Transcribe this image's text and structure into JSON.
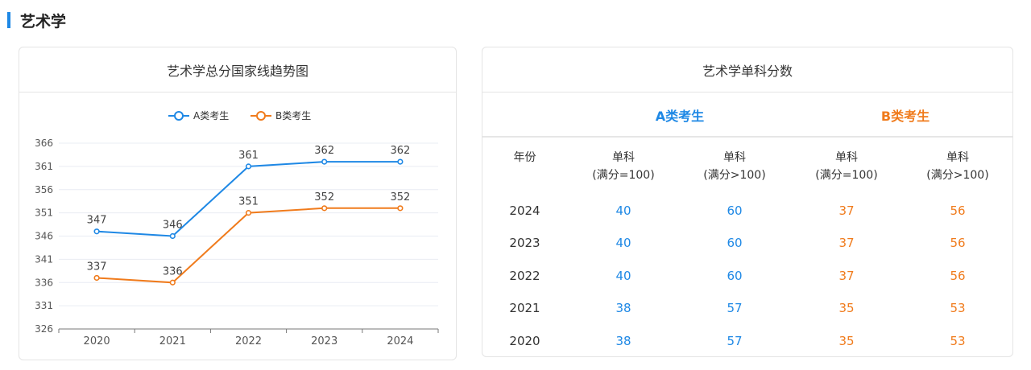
{
  "section": {
    "title": "艺术学"
  },
  "colors": {
    "accent": "#1e88e5",
    "series_a": "#1e88e5",
    "series_b": "#f07b1c",
    "year_text": "#333333"
  },
  "chart_card": {
    "title": "艺术学总分国家线趋势图"
  },
  "chart_data": {
    "type": "line",
    "title": "艺术学总分国家线趋势图",
    "x": [
      "2020",
      "2021",
      "2022",
      "2023",
      "2024"
    ],
    "series": [
      {
        "name": "A类考生",
        "values": [
          347,
          346,
          361,
          362,
          362
        ],
        "color": "#1e88e5"
      },
      {
        "name": "B类考生",
        "values": [
          337,
          336,
          351,
          352,
          352
        ],
        "color": "#f07b1c"
      }
    ],
    "yticks": [
      326,
      331,
      336,
      341,
      346,
      351,
      356,
      361,
      366
    ],
    "ylim": [
      326,
      366
    ],
    "xlabel": "",
    "ylabel": "",
    "grid": true,
    "legend": "top-center",
    "data_labels": true
  },
  "table_card": {
    "title": "艺术学单科分数",
    "group_a": "A类考生",
    "group_b": "B类考生",
    "headers": [
      {
        "line1": "年份",
        "line2": ""
      },
      {
        "line1": "单科",
        "line2": "(满分=100)"
      },
      {
        "line1": "单科",
        "line2": "(满分>100)"
      },
      {
        "line1": "单科",
        "line2": "(满分=100)"
      },
      {
        "line1": "单科",
        "line2": "(满分>100)"
      }
    ],
    "rows": [
      [
        "2024",
        "40",
        "60",
        "37",
        "56"
      ],
      [
        "2023",
        "40",
        "60",
        "37",
        "56"
      ],
      [
        "2022",
        "40",
        "60",
        "37",
        "56"
      ],
      [
        "2021",
        "38",
        "57",
        "35",
        "53"
      ],
      [
        "2020",
        "38",
        "57",
        "35",
        "53"
      ]
    ]
  }
}
